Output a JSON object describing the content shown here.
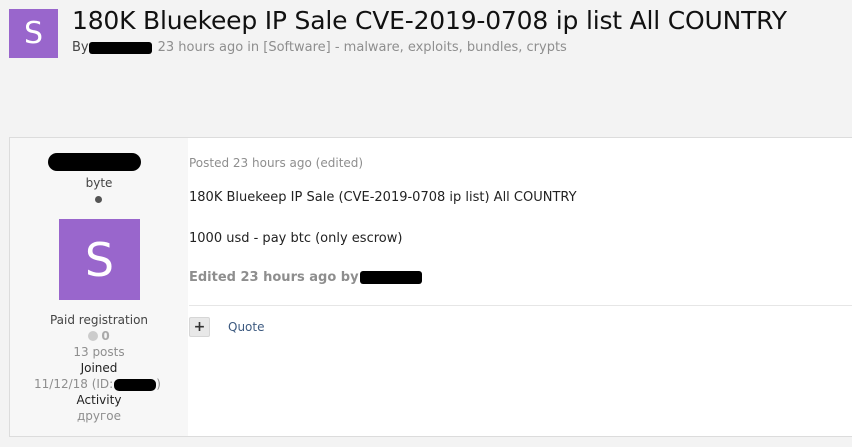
{
  "topic": {
    "avatar_letter": "S",
    "title": "180K Bluekeep IP Sale CVE-2019-0708 ip list All COUNTRY",
    "by_label": "By",
    "time_in": "23 hours ago in",
    "forum_link": "[Software] - malware, exploits, bundles, crypts"
  },
  "author": {
    "rank": "byte",
    "avatar_letter": "S",
    "group": "Paid registration",
    "reputation": "0",
    "posts": "13 posts",
    "joined_label": "Joined",
    "joined_value": "11/12/18 (ID:",
    "joined_suffix": ")",
    "activity_label": "Activity",
    "activity_value": "другое"
  },
  "post": {
    "meta": "Posted 23 hours ago (edited)",
    "line1": "180K Bluekeep IP Sale (CVE-2019-0708 ip list) All COUNTRY",
    "line2": "1000 usd - pay btc (only escrow)",
    "edited": "Edited 23 hours ago by",
    "plus_label": "+",
    "quote_label": "Quote"
  },
  "colors": {
    "avatar_bg": "#9966cc",
    "link": "#3d5a80",
    "muted": "#8e8e8e"
  }
}
